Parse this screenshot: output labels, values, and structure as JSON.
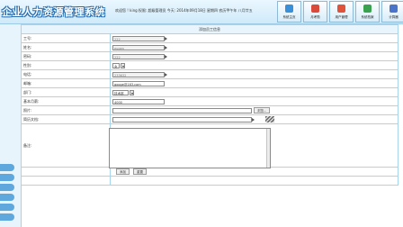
{
  "app": {
    "title": "企业人力资源管理系统"
  },
  "header": {
    "welcome": "欢迎您 ! king  权限: 超级管理员  今天: 2014年09月18日 星期四 农历甲午年 八月廿五",
    "buttons": [
      {
        "label": "系统主页",
        "color": "#3a8fd9"
      },
      {
        "label": "月考勤",
        "color": "#d94a3a"
      },
      {
        "label": "用户管理",
        "color": "#e0533a"
      },
      {
        "label": "系统档案",
        "color": "#3aa24f"
      },
      {
        "label": "计算器",
        "color": "#4a74c9"
      }
    ]
  },
  "form": {
    "caption": "添加员工信息",
    "fields": {
      "work_no": {
        "label": "工号:",
        "value": "222"
      },
      "name": {
        "label": "姓名:",
        "value": "eugen"
      },
      "password": {
        "label": "密码:",
        "value": "222"
      },
      "gender": {
        "label": "性别:",
        "value": "女"
      },
      "phone": {
        "label": "电话:",
        "value": "233632"
      },
      "email": {
        "label": "邮箱:",
        "value": "googe@163.com"
      },
      "department": {
        "label": "部门:",
        "value": "技术部"
      },
      "salary": {
        "label": "基本月薪:",
        "value": "4000"
      },
      "photo": {
        "label": "照片:",
        "value": ""
      },
      "resume": {
        "label": "简历文档:",
        "value": ""
      },
      "remark": {
        "label": "备注:",
        "value": ""
      }
    },
    "browse_button": "浏览...",
    "submit_button": "添加",
    "reset_button": "重置"
  }
}
